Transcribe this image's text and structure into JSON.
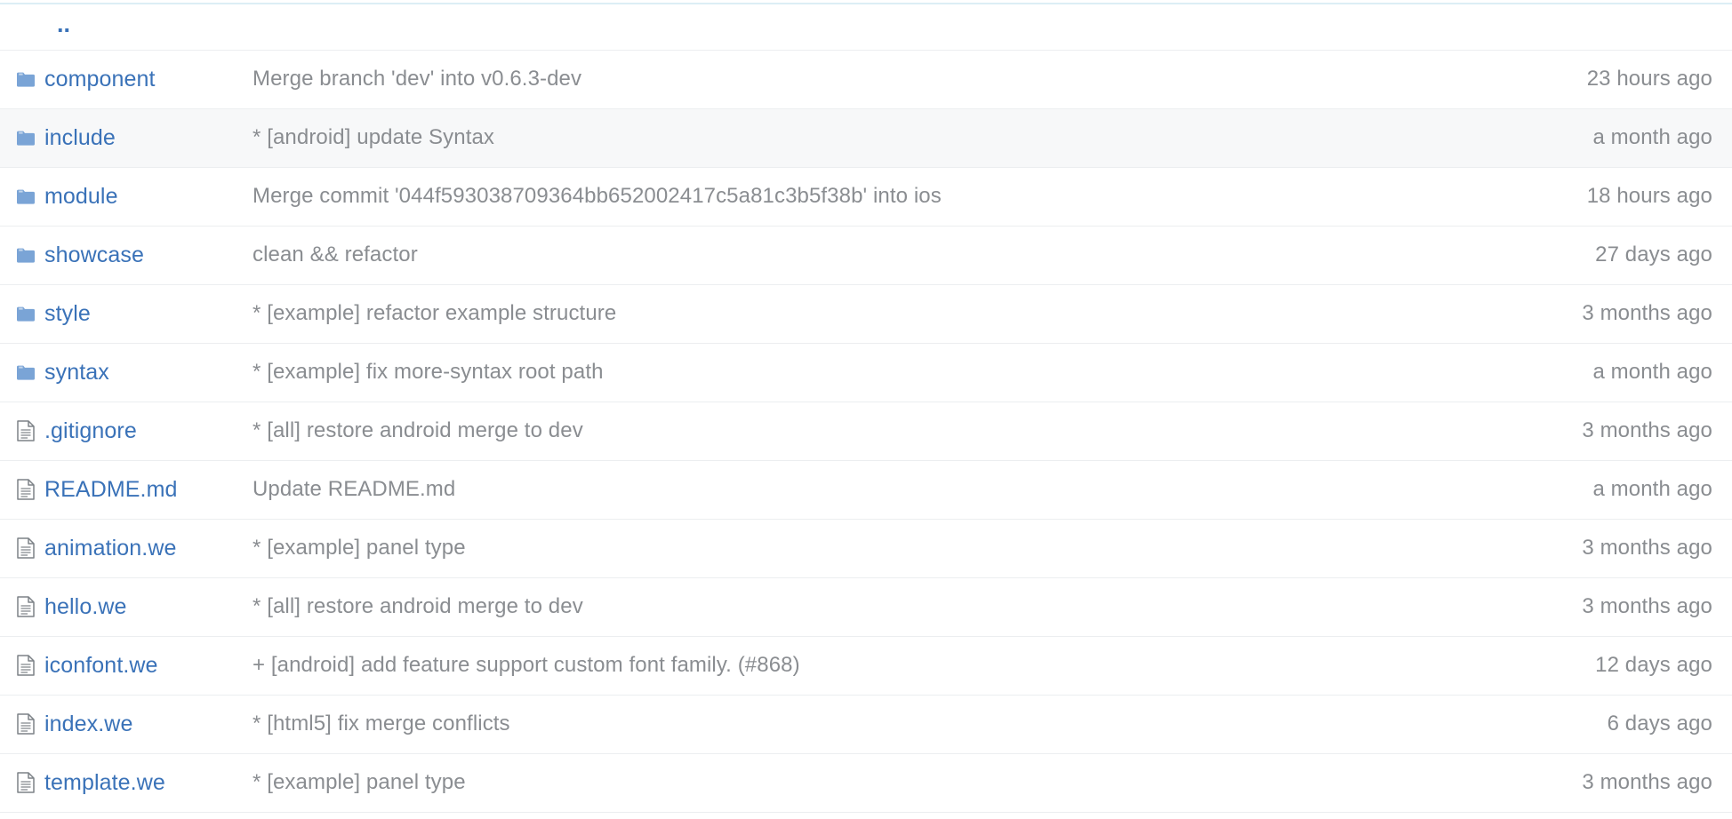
{
  "colors": {
    "link": "#3a72b8",
    "muted_text": "#8a8d91",
    "folder_icon": "#7aa4d6",
    "file_icon": "#7d8287",
    "row_alt_bg": "#f7f8f9",
    "row_border": "#eceef0",
    "top_rule": "#dceef5"
  },
  "parent_row": {
    "label": "..",
    "icon": "parent-directory-icon"
  },
  "rows": [
    {
      "icon": "folder-icon",
      "type": "folder",
      "name": "component",
      "message": "Merge branch 'dev' into v0.6.3-dev",
      "time": "23 hours ago",
      "alt": false
    },
    {
      "icon": "folder-icon",
      "type": "folder",
      "name": "include",
      "message": "* [android] update Syntax",
      "time": "a month ago",
      "alt": true
    },
    {
      "icon": "folder-icon",
      "type": "folder",
      "name": "module",
      "message": "Merge commit '044f593038709364bb652002417c5a81c3b5f38b' into ios",
      "time": "18 hours ago",
      "alt": false
    },
    {
      "icon": "folder-icon",
      "type": "folder",
      "name": "showcase",
      "message": "clean && refactor",
      "time": "27 days ago",
      "alt": false
    },
    {
      "icon": "folder-icon",
      "type": "folder",
      "name": "style",
      "message": "* [example] refactor example structure",
      "time": "3 months ago",
      "alt": false
    },
    {
      "icon": "folder-icon",
      "type": "folder",
      "name": "syntax",
      "message": "* [example] fix more-syntax root path",
      "time": "a month ago",
      "alt": false
    },
    {
      "icon": "file-icon",
      "type": "file",
      "name": ".gitignore",
      "message": "* [all] restore android merge to dev",
      "time": "3 months ago",
      "alt": false
    },
    {
      "icon": "file-icon",
      "type": "file",
      "name": "README.md",
      "message": "Update README.md",
      "time": "a month ago",
      "alt": false
    },
    {
      "icon": "file-icon",
      "type": "file",
      "name": "animation.we",
      "message": "* [example] panel type",
      "time": "3 months ago",
      "alt": false
    },
    {
      "icon": "file-icon",
      "type": "file",
      "name": "hello.we",
      "message": "* [all] restore android merge to dev",
      "time": "3 months ago",
      "alt": false
    },
    {
      "icon": "file-icon",
      "type": "file",
      "name": "iconfont.we",
      "message": "+ [android] add feature support custom font family. (#868)",
      "time": "12 days ago",
      "alt": false
    },
    {
      "icon": "file-icon",
      "type": "file",
      "name": "index.we",
      "message": "* [html5] fix merge conflicts",
      "time": "6 days ago",
      "alt": false
    },
    {
      "icon": "file-icon",
      "type": "file",
      "name": "template.we",
      "message": "* [example] panel type",
      "time": "3 months ago",
      "alt": false
    }
  ]
}
